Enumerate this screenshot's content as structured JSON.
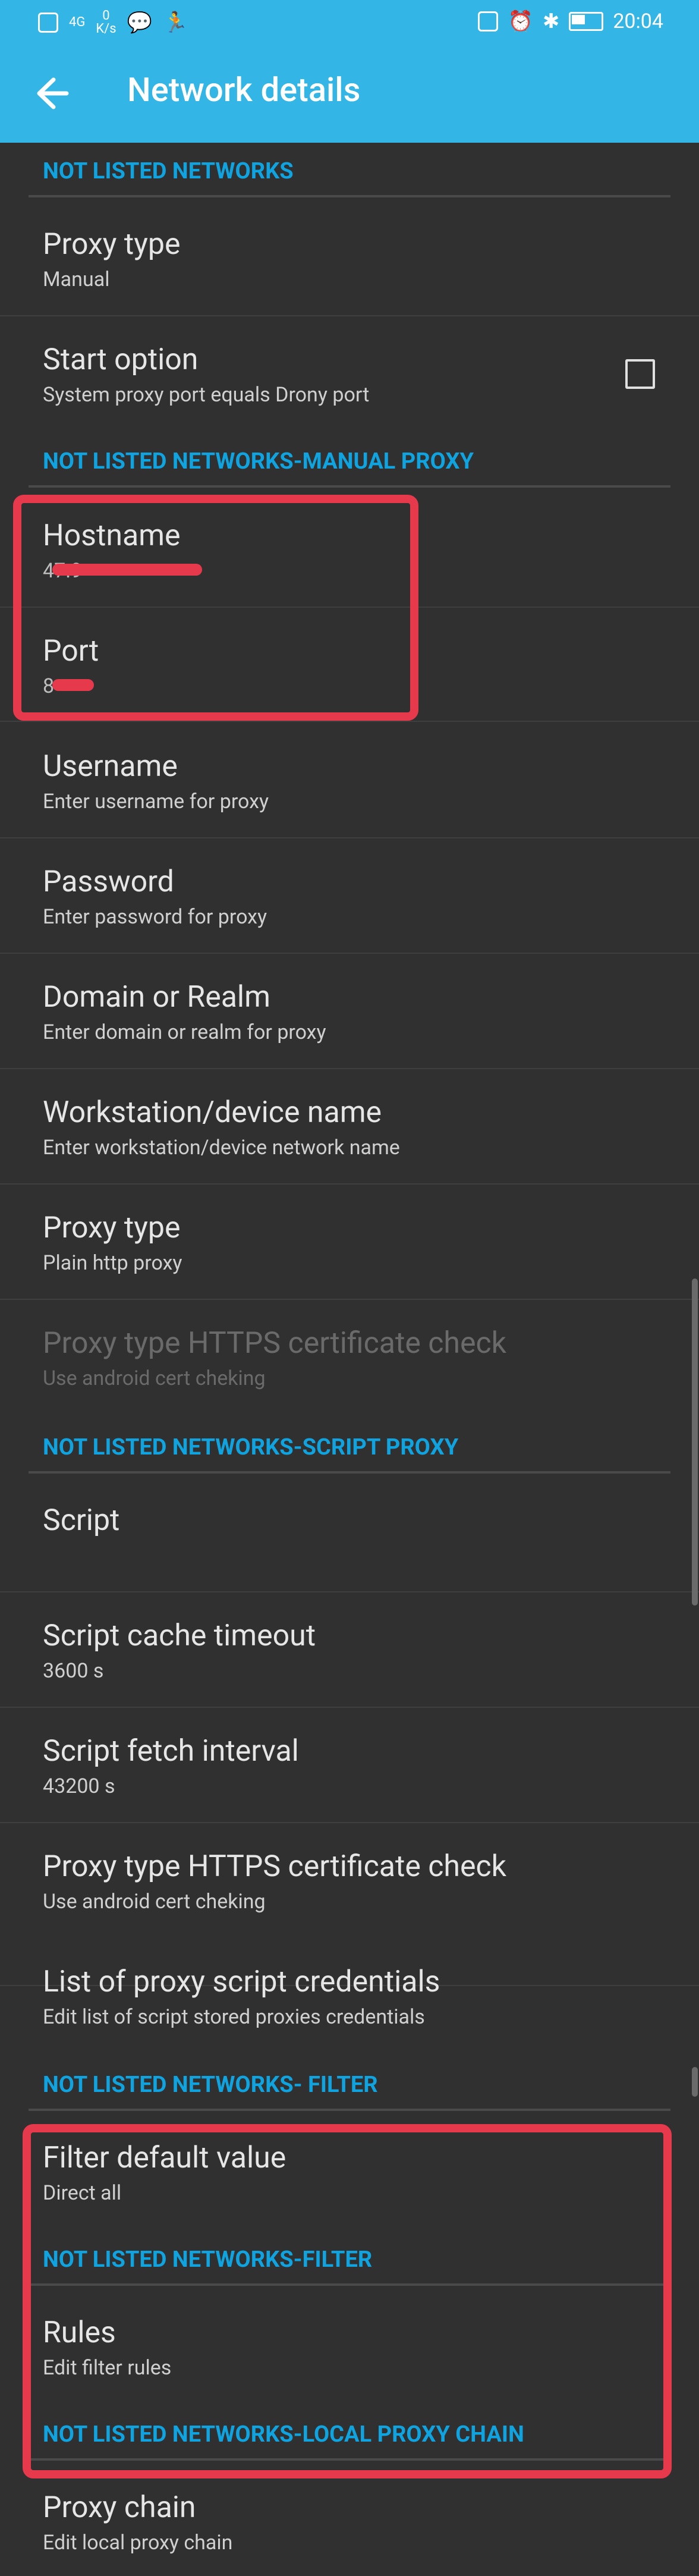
{
  "statusbar": {
    "left_icons": [
      "nfc-icon",
      "4g-icon",
      "network-speed-icon",
      "wechat-icon",
      "runner-icon"
    ],
    "speed_value": "0",
    "speed_unit": "K/s",
    "time": "20:04"
  },
  "appbar": {
    "title": "Network details"
  },
  "sections": {
    "not_listed": "NOT LISTED NETWORKS",
    "manual_proxy": "NOT LISTED NETWORKS-MANUAL PROXY",
    "script_proxy": "NOT LISTED NETWORKS-SCRIPT PROXY",
    "filter_a": "NOT LISTED NETWORKS- FILTER",
    "filter_b": "NOT LISTED NETWORKS-FILTER",
    "local_chain": "NOT LISTED NETWORKS-LOCAL PROXY CHAIN"
  },
  "items": {
    "proxy_type_1": {
      "title": "Proxy type",
      "sub": "Manual"
    },
    "start_option": {
      "title": "Start option",
      "sub": "System proxy port equals Drony port"
    },
    "hostname": {
      "title": "Hostname",
      "sub": "47.9"
    },
    "port": {
      "title": "Port",
      "sub": "8"
    },
    "username": {
      "title": "Username",
      "sub": "Enter username for proxy"
    },
    "password": {
      "title": "Password",
      "sub": "Enter password for proxy"
    },
    "domain": {
      "title": "Domain or Realm",
      "sub": "Enter domain or realm for proxy"
    },
    "workstation": {
      "title": "Workstation/device name",
      "sub": "Enter workstation/device network name"
    },
    "proxy_type_2": {
      "title": "Proxy type",
      "sub": "Plain http proxy"
    },
    "https_check_disabled": {
      "title": "Proxy type HTTPS certificate check",
      "sub": "Use android cert cheking"
    },
    "script": {
      "title": "Script",
      "sub": ""
    },
    "script_cache": {
      "title": "Script cache timeout",
      "sub": "3600 s"
    },
    "script_fetch": {
      "title": "Script fetch interval",
      "sub": "43200 s"
    },
    "https_check": {
      "title": "Proxy type HTTPS certificate check",
      "sub": "Use android cert cheking"
    },
    "credentials": {
      "title": "List of proxy script credentials",
      "sub": "Edit list of script stored proxies credentials"
    },
    "filter_default": {
      "title": "Filter default value",
      "sub": "Direct all"
    },
    "rules": {
      "title": "Rules",
      "sub": "Edit filter rules"
    },
    "proxy_chain": {
      "title": "Proxy chain",
      "sub": "Edit local proxy chain"
    }
  },
  "colors": {
    "accent": "#33b6e5",
    "section": "#0fa3e0",
    "highlight": "#e7394c",
    "background": "#303030"
  }
}
